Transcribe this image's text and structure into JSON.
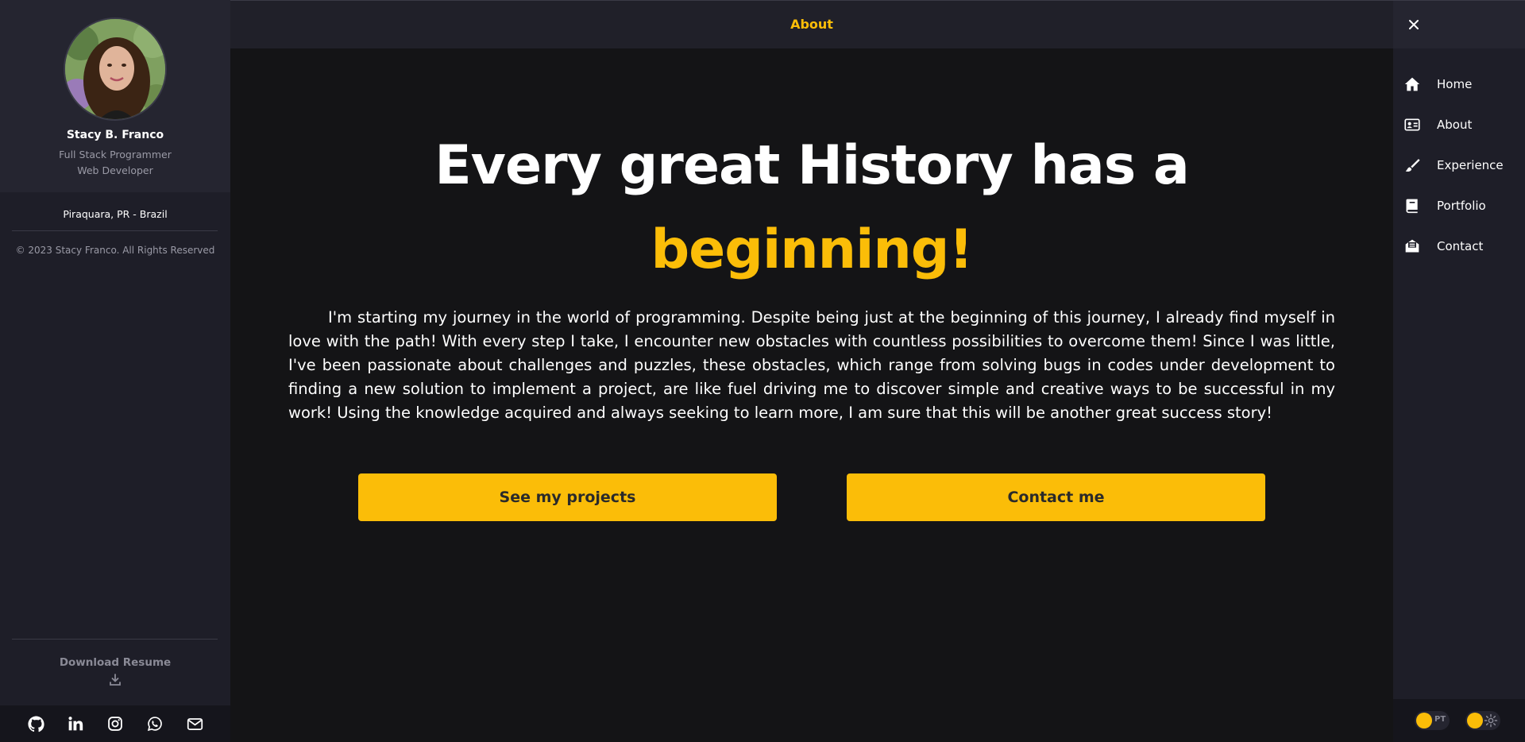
{
  "profile": {
    "name": "Stacy B. Franco",
    "roles": [
      "Full Stack Programmer",
      "Web Developer"
    ],
    "location": "Piraquara, PR - Brazil",
    "copyright": "© 2023 Stacy Franco. All Rights Reserved"
  },
  "resume": {
    "label": "Download Resume",
    "icon": "download-icon"
  },
  "socials": [
    {
      "name": "github-icon"
    },
    {
      "name": "linkedin-icon"
    },
    {
      "name": "instagram-icon"
    },
    {
      "name": "whatsapp-icon"
    },
    {
      "name": "mail-icon"
    }
  ],
  "topbar": {
    "title": "About"
  },
  "nav": {
    "close_icon": "close-icon",
    "items": [
      {
        "label": "Home",
        "icon": "home-icon"
      },
      {
        "label": "About",
        "icon": "id-card-icon"
      },
      {
        "label": "Experience",
        "icon": "brush-icon"
      },
      {
        "label": "Portfolio",
        "icon": "book-icon"
      },
      {
        "label": "Contact",
        "icon": "mail-open-icon"
      }
    ],
    "language_toggle": "PT",
    "theme_toggle_icon": "gear-icon"
  },
  "main": {
    "headline_line1": "Every great History has a",
    "headline_line2": "beginning!",
    "intro": "I'm starting my journey in the world of programming. Despite being just at the beginning of this journey, I already find myself in love with the path! With every step I take, I encounter new obstacles with countless possibilities to overcome them! Since I was little, I've been passionate about challenges and puzzles, these obstacles, which range from solving bugs in codes under development to finding a new solution to implement a project, are like fuel driving me to discover simple and creative ways to be successful in my work! Using the knowledge acquired and always seeking to learn more, I am sure that this will be another great success story!",
    "buttons": {
      "projects": "See my projects",
      "contact": "Contact me"
    }
  },
  "colors": {
    "accent": "#fbbd08",
    "background": "#141416",
    "sidebar": "#1e1e28",
    "text_muted": "#9a9aa6"
  }
}
